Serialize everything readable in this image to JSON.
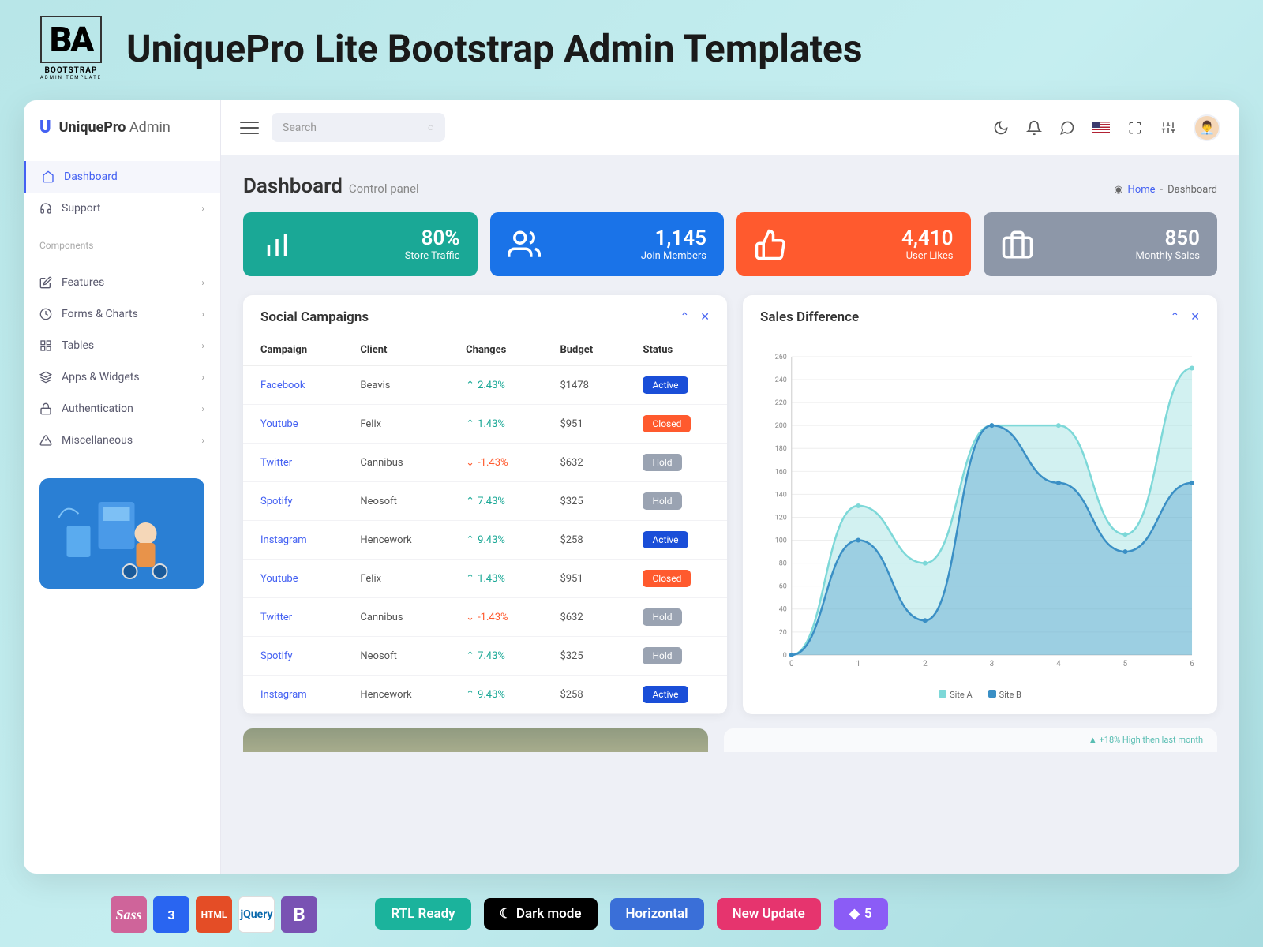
{
  "promo": {
    "logo_main": "BA",
    "logo_sub1": "BOOTSTRAP",
    "logo_sub2": "ADMIN TEMPLATE",
    "title": "UniquePro Lite Bootstrap Admin Templates"
  },
  "brand": {
    "icon": "U",
    "name": "UniquePro",
    "suffix": "Admin"
  },
  "search": {
    "placeholder": "Search"
  },
  "sidebar": {
    "items": [
      {
        "icon": "home",
        "label": "Dashboard",
        "active": true,
        "expandable": false
      },
      {
        "icon": "headphones",
        "label": "Support",
        "expandable": true
      }
    ],
    "section": "Components",
    "items2": [
      {
        "icon": "edit",
        "label": "Features"
      },
      {
        "icon": "clock",
        "label": "Forms & Charts"
      },
      {
        "icon": "grid",
        "label": "Tables"
      },
      {
        "icon": "layers",
        "label": "Apps & Widgets"
      },
      {
        "icon": "lock",
        "label": "Authentication"
      },
      {
        "icon": "alert",
        "label": "Miscellaneous"
      }
    ]
  },
  "page": {
    "title": "Dashboard",
    "subtitle": "Control panel",
    "crumb_home": "Home",
    "crumb_current": "Dashboard"
  },
  "stats": [
    {
      "value": "80%",
      "label": "Store Traffic",
      "color": "teal",
      "icon": "bars"
    },
    {
      "value": "1,145",
      "label": "Join Members",
      "color": "blue",
      "icon": "users"
    },
    {
      "value": "4,410",
      "label": "User Likes",
      "color": "orange",
      "icon": "thumb"
    },
    {
      "value": "850",
      "label": "Monthly Sales",
      "color": "grey",
      "icon": "briefcase"
    }
  ],
  "social": {
    "title": "Social Campaigns",
    "headers": [
      "Campaign",
      "Client",
      "Changes",
      "Budget",
      "Status"
    ],
    "rows": [
      {
        "campaign": "Facebook",
        "client": "Beavis",
        "change": "2.43%",
        "dir": "up",
        "budget": "$1478",
        "status": "Active"
      },
      {
        "campaign": "Youtube",
        "client": "Felix",
        "change": "1.43%",
        "dir": "up",
        "budget": "$951",
        "status": "Closed"
      },
      {
        "campaign": "Twitter",
        "client": "Cannibus",
        "change": "-1.43%",
        "dir": "down",
        "budget": "$632",
        "status": "Hold"
      },
      {
        "campaign": "Spotify",
        "client": "Neosoft",
        "change": "7.43%",
        "dir": "up",
        "budget": "$325",
        "status": "Hold"
      },
      {
        "campaign": "Instagram",
        "client": "Hencework",
        "change": "9.43%",
        "dir": "up",
        "budget": "$258",
        "status": "Active"
      },
      {
        "campaign": "Youtube",
        "client": "Felix",
        "change": "1.43%",
        "dir": "up",
        "budget": "$951",
        "status": "Closed"
      },
      {
        "campaign": "Twitter",
        "client": "Cannibus",
        "change": "-1.43%",
        "dir": "down",
        "budget": "$632",
        "status": "Hold"
      },
      {
        "campaign": "Spotify",
        "client": "Neosoft",
        "change": "7.43%",
        "dir": "up",
        "budget": "$325",
        "status": "Hold"
      },
      {
        "campaign": "Instagram",
        "client": "Hencework",
        "change": "9.43%",
        "dir": "up",
        "budget": "$258",
        "status": "Active"
      }
    ]
  },
  "sales": {
    "title": "Sales Difference",
    "legend_a": "Site A",
    "legend_b": "Site B"
  },
  "chart_data": {
    "type": "area",
    "x": [
      0,
      1,
      2,
      3,
      4,
      5,
      6
    ],
    "ylim": [
      0,
      260
    ],
    "xticks": [
      0,
      1,
      2,
      3,
      4,
      5,
      6
    ],
    "yticks": [
      0,
      20,
      40,
      60,
      80,
      100,
      120,
      140,
      160,
      180,
      200,
      220,
      240,
      260
    ],
    "series": [
      {
        "name": "Site A",
        "color": "#7dd8d8",
        "values": [
          0,
          130,
          80,
          200,
          200,
          105,
          250
        ]
      },
      {
        "name": "Site B",
        "color": "#3a8fc5",
        "values": [
          0,
          100,
          30,
          200,
          150,
          90,
          150
        ]
      }
    ]
  },
  "peek_text": "+18% High then last month",
  "footer": {
    "rtl": "RTL Ready",
    "dark": "Dark mode",
    "horizontal": "Horizontal",
    "update": "New Update",
    "bs_version": "5"
  },
  "tech": {
    "sass": "Sass",
    "css": "3",
    "html": "HTML",
    "jquery": "jQuery"
  }
}
